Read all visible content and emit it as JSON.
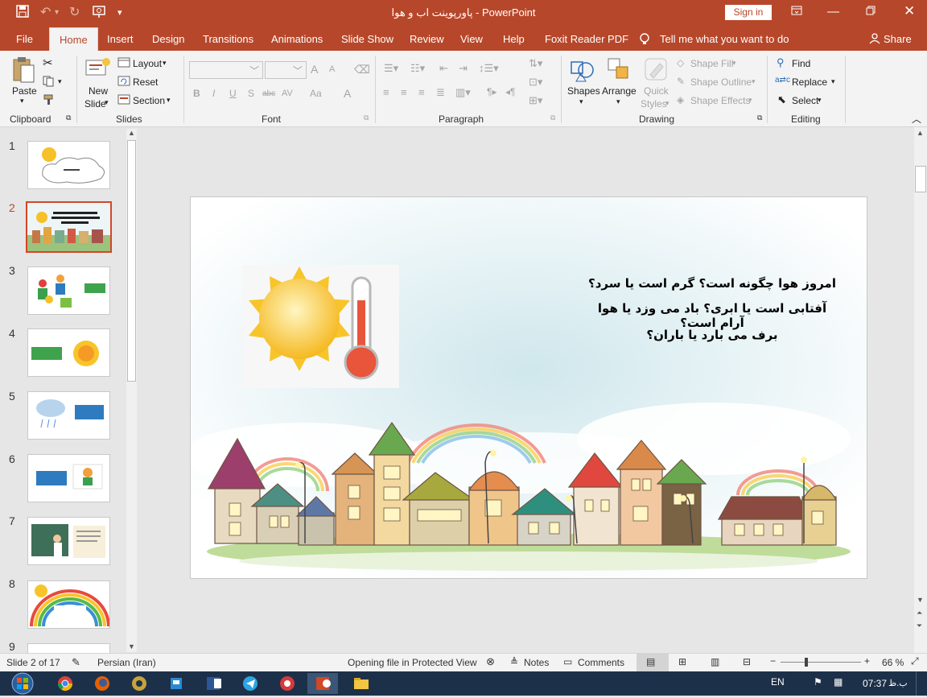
{
  "titlebar": {
    "doc_title": "پاورپوینت اب و هوا",
    "app_name": "PowerPoint",
    "separator": " - ",
    "sign_in": "Sign in"
  },
  "tabs": [
    "File",
    "Home",
    "Insert",
    "Design",
    "Transitions",
    "Animations",
    "Slide Show",
    "Review",
    "View",
    "Help",
    "Foxit Reader PDF"
  ],
  "active_tab": "Home",
  "tell_me": "Tell me what you want to do",
  "share": "Share",
  "ribbon": {
    "clipboard": {
      "label": "Clipboard",
      "paste": "Paste"
    },
    "slides": {
      "label": "Slides",
      "new_slide_1": "New",
      "new_slide_2": "Slide",
      "layout": "Layout",
      "reset": "Reset",
      "section": "Section"
    },
    "font": {
      "label": "Font",
      "bold": "B",
      "italic": "I",
      "underline": "U",
      "shadow": "S",
      "strike": "abc",
      "spacing": "AV",
      "grow": "A",
      "shrink": "A",
      "case": "Aa",
      "clear": "A"
    },
    "paragraph": {
      "label": "Paragraph"
    },
    "drawing": {
      "label": "Drawing",
      "shapes": "Shapes",
      "arrange": "Arrange",
      "quick_styles_1": "Quick",
      "quick_styles_2": "Styles",
      "shape_fill": "Shape Fill",
      "shape_outline": "Shape Outline",
      "shape_effects": "Shape Effects"
    },
    "editing": {
      "label": "Editing",
      "find": "Find",
      "replace": "Replace",
      "select": "Select"
    }
  },
  "thumbnails": [
    "1",
    "2",
    "3",
    "4",
    "5",
    "6",
    "7",
    "8",
    "9"
  ],
  "selected_slide": "2",
  "slide": {
    "line1": "امروز هوا چگونه است؟ گرم است یا سرد؟",
    "line2": "آفتابی است یا ابری؟ باد می وزد یا هوا آرام است؟",
    "line3": "برف می بارد یا باران؟"
  },
  "status": {
    "slide_of": "Slide 2 of 17",
    "language": "Persian (Iran)",
    "protected": "Opening file in Protected View",
    "notes": "Notes",
    "comments": "Comments",
    "zoom": "66 %"
  },
  "taskbar": {
    "lang": "EN",
    "time": "07:37",
    "ampm": "ب.ظ"
  },
  "colors": {
    "accent": "#b7472a",
    "selected_thumb": "#d24726",
    "taskbar": "#1d3049"
  }
}
